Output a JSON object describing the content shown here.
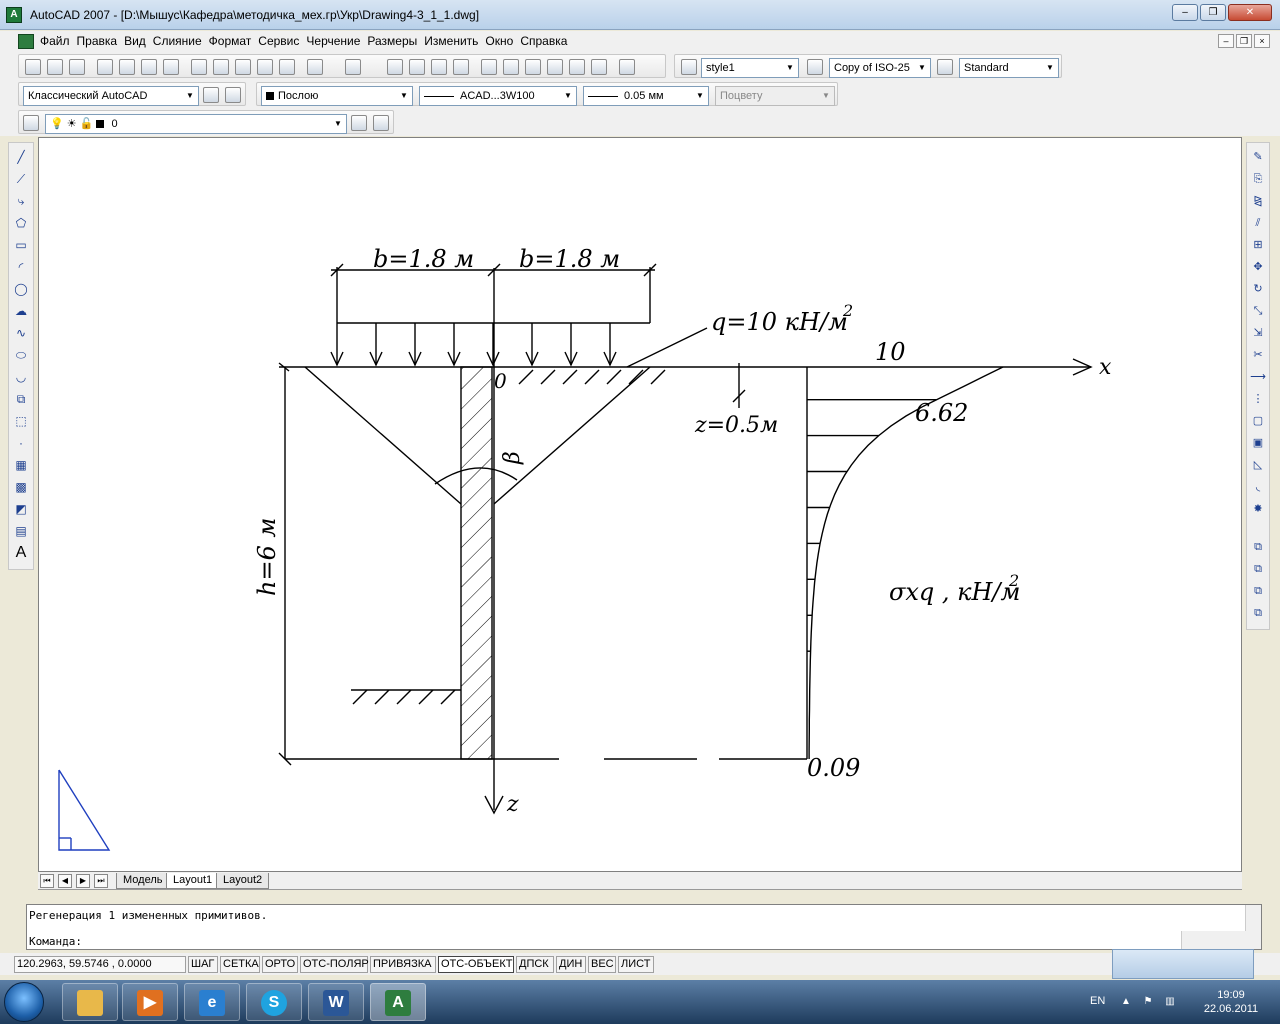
{
  "window": {
    "title": "AutoCAD 2007 - [D:\\Мышус\\Кафедра\\методичка_мех.гр\\Укр\\Drawing4-3_1_1.dwg]",
    "minimize": "‒",
    "restore": "❐",
    "close": "✕"
  },
  "menu": {
    "items": [
      "Файл",
      "Правка",
      "Вид",
      "Слияние",
      "Формат",
      "Сервис",
      "Черчение",
      "Размеры",
      "Изменить",
      "Окно",
      "Справка"
    ]
  },
  "toolbars": {
    "text_style": "style1",
    "dim_style": "Copy of ISO-25",
    "table_style": "Standard",
    "workspace": "Классический AutoCAD",
    "color": "Послою",
    "linetype": "ACAD...3W100",
    "lineweight": "0.05 мм",
    "plot_style": "Поцвету",
    "layer": "0"
  },
  "drawing": {
    "b_left": "b=1.8 м",
    "b_right": "b=1.8 м",
    "load": "q=10 кН/м",
    "load_sup": "2",
    "origin": "0",
    "x_axis": "x",
    "z_axis": "z",
    "depth_label": "h=6 м",
    "z_label": "z=0.5м",
    "value_top": "10",
    "value_z": "6.62",
    "value_bottom": "0.09",
    "stress_label": "σxq , кН/м",
    "stress_sup": "2",
    "angle_label": "β",
    "stress_curve": [
      {
        "z": 0.0,
        "sigma": 10
      },
      {
        "z": 0.5,
        "sigma": 6.62
      },
      {
        "z": 6.0,
        "sigma": 0.09
      }
    ]
  },
  "layout_tabs": [
    "Модель",
    "Layout1",
    "Layout2"
  ],
  "active_layout": "Layout1",
  "command": {
    "history": "Регенерация 1 измененных примитивов.",
    "prompt": "Команда:"
  },
  "status": {
    "coords": "120.2963, 59.5746 , 0.0000",
    "buttons": [
      "ШАГ",
      "СЕТКА",
      "ОРТО",
      "ОТС-ПОЛЯР",
      "ПРИВЯЗКА",
      "ОТС-ОБЪЕКТ",
      "ДПСК",
      "ДИН",
      "ВЕС",
      "ЛИСТ"
    ]
  },
  "taskbar": {
    "language": "EN",
    "time": "19:09",
    "date": "22.06.2011"
  }
}
